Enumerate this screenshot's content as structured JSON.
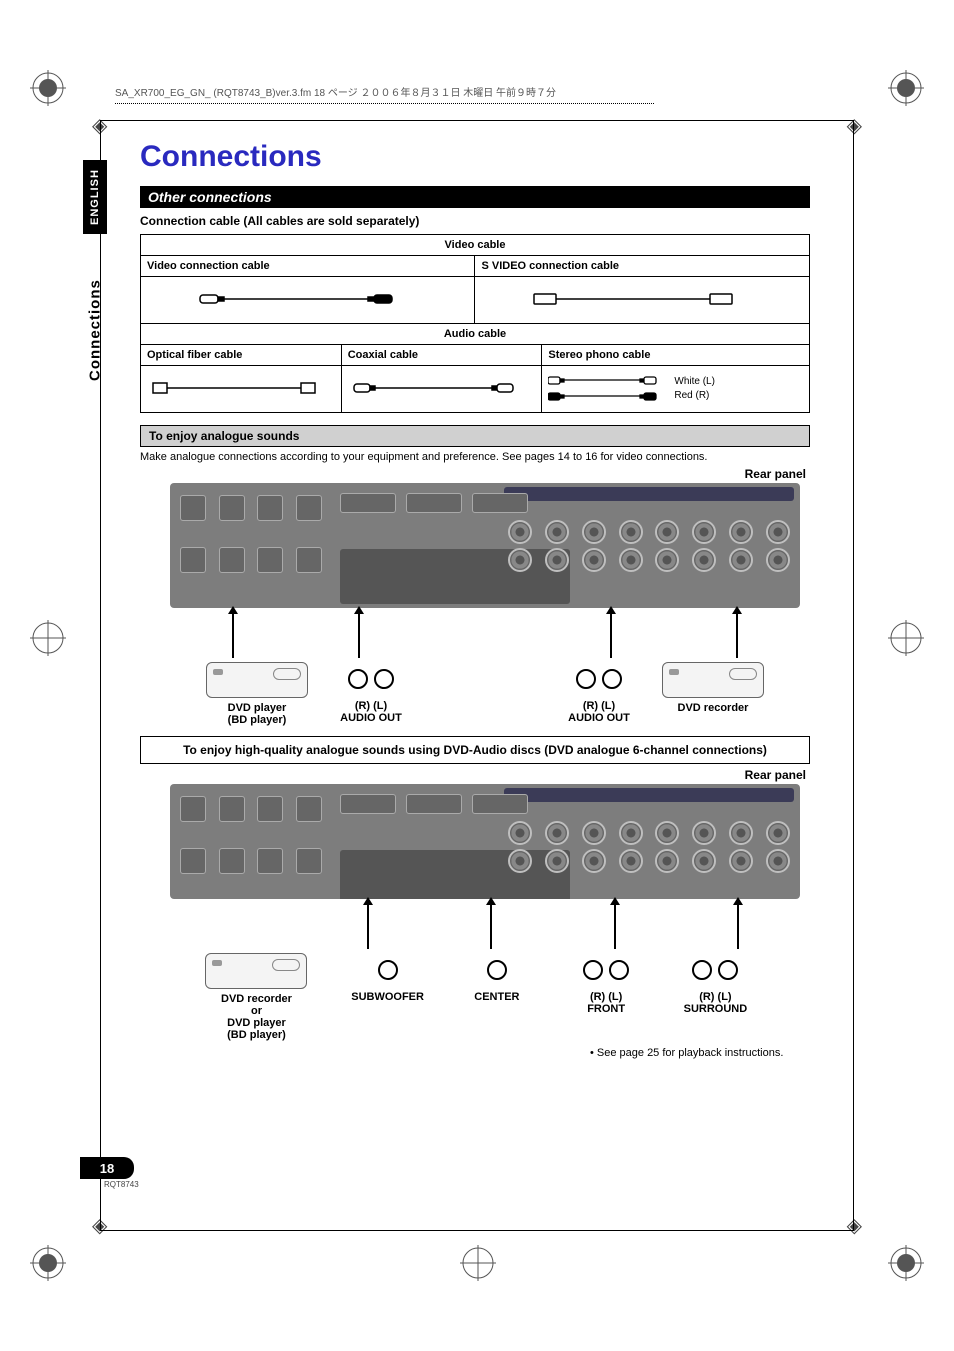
{
  "pagehead": "SA_XR700_EG_GN_ (RQT8743_B)ver.3.fm  18 ページ  ２００６年８月３１日  木曜日  午前９時７分",
  "title": "Connections",
  "lang_tab": "ENGLISH",
  "side_section": "Connections",
  "other_connections": "Other connections",
  "cable_note": "Connection cable (All cables are sold separately)",
  "tbl": {
    "video_header": "Video cable",
    "video_conn": "Video connection cable",
    "svideo_conn": "S VIDEO connection cable",
    "audio_header": "Audio cable",
    "optical": "Optical fiber cable",
    "coax": "Coaxial cable",
    "phono": "Stereo phono cable",
    "phono_white": "White (L)",
    "phono_red": "Red   (R)"
  },
  "analogue_bar": "To enjoy analogue sounds",
  "analogue_txt": "Make analogue connections according to your equipment and preference. See pages 14 to 16 for video connections.",
  "rear_panel": "Rear panel",
  "fig1": {
    "left_dev": "DVD player\n(BD player)",
    "mid_l": "(R) (L)\nAUDIO OUT",
    "mid_r": "(R) (L)\nAUDIO OUT",
    "right_dev": "DVD recorder"
  },
  "callout6ch": "To enjoy high-quality analogue sounds using DVD-Audio discs (DVD analogue 6-channel connections)",
  "fig2": {
    "left_dev": "DVD recorder\nor\nDVD player\n(BD player)",
    "sub": "SUBWOOFER",
    "center": "CENTER",
    "front": "(R) (L)\nFRONT",
    "surround": "(R) (L)\nSURROUND"
  },
  "foot": "• See page 25 for playback instructions.",
  "page_num": "18",
  "page_code": "RQT8743"
}
